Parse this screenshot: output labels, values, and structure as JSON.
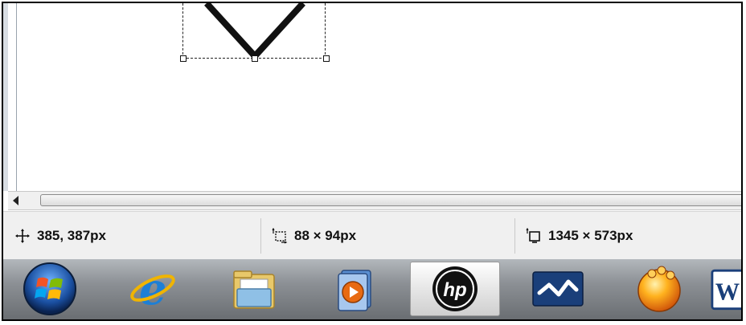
{
  "status": {
    "cursor_position": "385, 387px",
    "selection_size": "88 × 94px",
    "image_size": "1345 × 573px"
  },
  "icons": {
    "cursor_position": "move-crosshair-icon",
    "selection_size": "selection-size-icon",
    "image_size": "canvas-size-icon"
  },
  "taskbar": {
    "items": [
      {
        "name": "start-button",
        "icon": "windows-orb-icon"
      },
      {
        "name": "internet-explorer",
        "icon": "internet-explorer-icon"
      },
      {
        "name": "windows-explorer",
        "icon": "folder-icon"
      },
      {
        "name": "media-player",
        "icon": "media-player-icon"
      },
      {
        "name": "hp-app",
        "icon": "hp-logo-icon",
        "active": true
      },
      {
        "name": "app-blue-wave",
        "icon": "wave-app-icon"
      },
      {
        "name": "app-orange-ball",
        "icon": "orange-ball-icon"
      },
      {
        "name": "word",
        "icon": "word-icon"
      }
    ]
  },
  "colors": {
    "taskbar_bg": "#8c9095",
    "statusbar_bg": "#f0f0f0",
    "hp_blue": "#0a5ea8"
  }
}
